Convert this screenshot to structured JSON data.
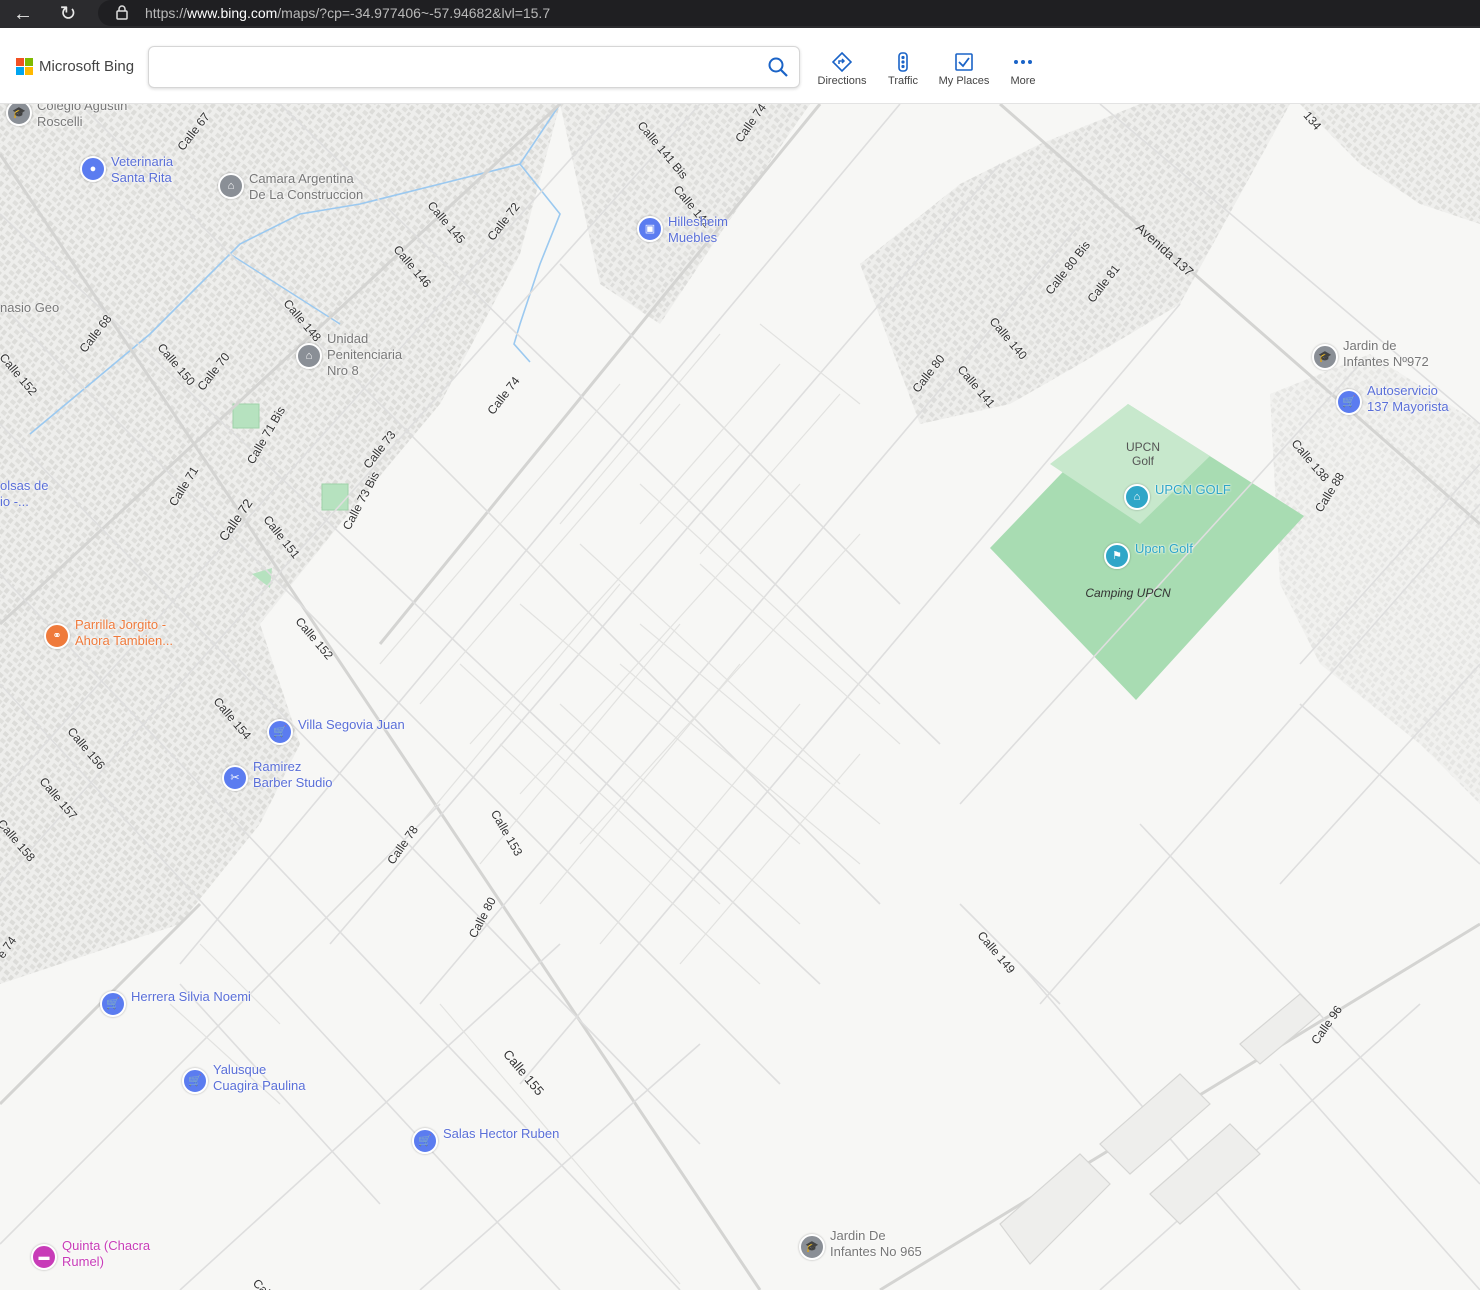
{
  "browser": {
    "url_prefix": "https://",
    "url_host": "www.bing.com",
    "url_path": "/maps/?cp=-34.977406~-57.94682&lvl=15.7"
  },
  "header": {
    "logo_text": "Microsoft Bing",
    "search": {
      "value": "",
      "placeholder": ""
    },
    "tools": [
      {
        "label": "Directions",
        "icon": "directions-icon"
      },
      {
        "label": "Traffic",
        "icon": "traffic-icon"
      },
      {
        "label": "My Places",
        "icon": "my-places-icon"
      },
      {
        "label": "More",
        "icon": "more-icon"
      }
    ]
  },
  "colors": {
    "poi_blue": "#5b7cf0",
    "poi_blue_text": "#5a6fd8",
    "poi_orange": "#ef7a3b",
    "poi_pink": "#c83cb8",
    "poi_gray": "#8a8f96",
    "poi_teal": "#2fa6c8",
    "park": "#a8dcb2",
    "road": "#d8d8d8",
    "map_bg": "#f7f7f5"
  },
  "pois": [
    {
      "name": "Colegio Agustin\nRoscelli",
      "type": "school",
      "icon": "school-icon"
    },
    {
      "name": "Veterinaria\nSanta Rita",
      "type": "pet",
      "icon": "paw-icon"
    },
    {
      "name": "Camara Argentina\nDe La Construccion",
      "type": "building",
      "icon": "government-icon"
    },
    {
      "name": "Hillesheim\nMuebles",
      "type": "store",
      "icon": "shopping-bag-icon"
    },
    {
      "name": "Unidad\nPenitenciaria\nNro 8",
      "type": "building",
      "icon": "government-icon"
    },
    {
      "name": "Jardin de\nInfantes Nº972",
      "type": "school",
      "icon": "school-icon"
    },
    {
      "name": "Autoservicio\n137 Mayorista",
      "type": "shop",
      "icon": "cart-icon"
    },
    {
      "name": "UPCN GOLF",
      "type": "golf",
      "icon": "golf-icon"
    },
    {
      "name": "Upcn Golf",
      "type": "golf",
      "icon": "golf-flag-icon"
    },
    {
      "name": "Parrilla Jorgito -\nAhora Tambien...",
      "type": "restaurant",
      "icon": "fork-knife-icon"
    },
    {
      "name": "Villa Segovia Juan",
      "type": "shop",
      "icon": "cart-icon"
    },
    {
      "name": "Ramirez\nBarber Studio",
      "type": "salon",
      "icon": "scissors-icon"
    },
    {
      "name": "Herrera Silvia Noemi",
      "type": "shop",
      "icon": "cart-icon"
    },
    {
      "name": "Yalusque\nCuagira Paulina",
      "type": "shop",
      "icon": "cart-icon"
    },
    {
      "name": "Salas Hector Ruben",
      "type": "shop",
      "icon": "cart-icon"
    },
    {
      "name": "Jardin De\nInfantes No 965",
      "type": "school",
      "icon": "school-icon"
    },
    {
      "name": "Quinta (Chacra\nRumel)",
      "type": "lodging",
      "icon": "bed-icon"
    }
  ],
  "partial_labels": [
    "nasio Geo",
    "olsas de\nio -..."
  ],
  "areas": {
    "upcn_golf": "UPCN\nGolf",
    "camping": "Camping UPCN"
  },
  "streets": [
    "Calle 67",
    "Calle 141 Bis",
    "Calle 74",
    "134",
    "Calle 142",
    "Calle 145",
    "Calle 72",
    "Calle 146",
    "Avenida 137",
    "Calle 80 Bis",
    "Calle 81",
    "Calle 148",
    "Calle 68",
    "Calle 152",
    "Calle 150",
    "Calle 70",
    "Calle 140",
    "Calle 80",
    "Calle 141",
    "Calle 74",
    "Calle 71 Bis",
    "Calle 73",
    "Calle 138",
    "Calle 71",
    "Calle 88",
    "Calle 72",
    "Calle 73 Bis",
    "Calle 151",
    "Calle 152",
    "Calle 154",
    "Calle 156",
    "Calle 157",
    "Calle 158",
    "Calle 78",
    "Calle 153",
    "Calle 80",
    "Calle 149",
    "Calle 96",
    "e 74",
    "Calle 155",
    "Call"
  ]
}
